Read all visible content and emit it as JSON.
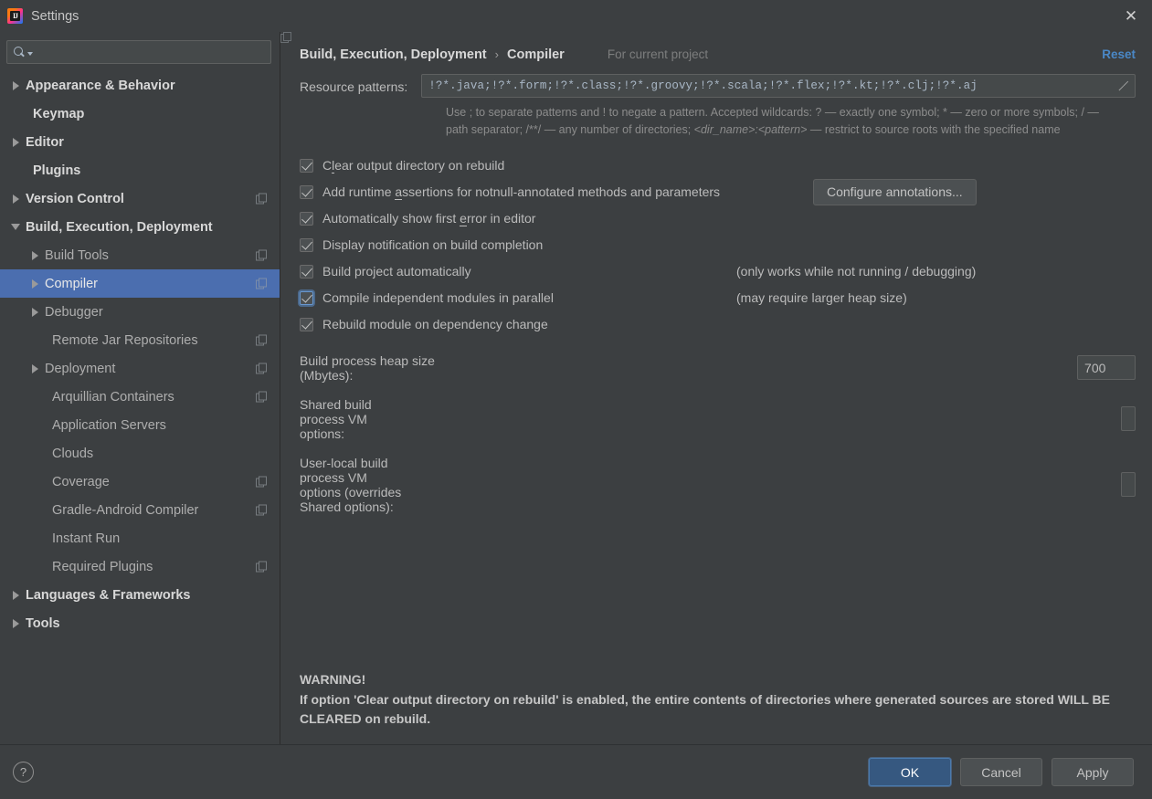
{
  "window": {
    "title": "Settings",
    "app_icon": "intellij-idea-icon",
    "close_icon": "close-icon"
  },
  "sidebar": {
    "search": {
      "placeholder": "",
      "value": "",
      "icon": "search-icon",
      "caret_icon": "chevron-down-icon"
    },
    "items": [
      {
        "label": "Appearance & Behavior",
        "level": 0,
        "arrow": "collapsed",
        "scope_icon": false,
        "selected": false
      },
      {
        "label": "Keymap",
        "level": 0,
        "arrow": "none",
        "scope_icon": false,
        "selected": false
      },
      {
        "label": "Editor",
        "level": 0,
        "arrow": "collapsed",
        "scope_icon": false,
        "selected": false
      },
      {
        "label": "Plugins",
        "level": 0,
        "arrow": "none",
        "scope_icon": false,
        "selected": false
      },
      {
        "label": "Version Control",
        "level": 0,
        "arrow": "collapsed",
        "scope_icon": true,
        "selected": false
      },
      {
        "label": "Build, Execution, Deployment",
        "level": 0,
        "arrow": "expanded",
        "scope_icon": false,
        "selected": false
      },
      {
        "label": "Build Tools",
        "level": 1,
        "arrow": "collapsed",
        "scope_icon": true,
        "selected": false
      },
      {
        "label": "Compiler",
        "level": 1,
        "arrow": "collapsed",
        "scope_icon": true,
        "selected": true
      },
      {
        "label": "Debugger",
        "level": 1,
        "arrow": "collapsed",
        "scope_icon": false,
        "selected": false
      },
      {
        "label": "Remote Jar Repositories",
        "level": 1,
        "arrow": "none",
        "scope_icon": true,
        "selected": false
      },
      {
        "label": "Deployment",
        "level": 1,
        "arrow": "collapsed",
        "scope_icon": true,
        "selected": false
      },
      {
        "label": "Arquillian Containers",
        "level": 1,
        "arrow": "none",
        "scope_icon": true,
        "selected": false
      },
      {
        "label": "Application Servers",
        "level": 1,
        "arrow": "none",
        "scope_icon": false,
        "selected": false
      },
      {
        "label": "Clouds",
        "level": 1,
        "arrow": "none",
        "scope_icon": false,
        "selected": false
      },
      {
        "label": "Coverage",
        "level": 1,
        "arrow": "none",
        "scope_icon": true,
        "selected": false
      },
      {
        "label": "Gradle-Android Compiler",
        "level": 1,
        "arrow": "none",
        "scope_icon": true,
        "selected": false
      },
      {
        "label": "Instant Run",
        "level": 1,
        "arrow": "none",
        "scope_icon": false,
        "selected": false
      },
      {
        "label": "Required Plugins",
        "level": 1,
        "arrow": "none",
        "scope_icon": true,
        "selected": false
      },
      {
        "label": "Languages & Frameworks",
        "level": 0,
        "arrow": "collapsed",
        "scope_icon": false,
        "selected": false
      },
      {
        "label": "Tools",
        "level": 0,
        "arrow": "collapsed",
        "scope_icon": false,
        "selected": false
      }
    ]
  },
  "header": {
    "breadcrumb_root": "Build, Execution, Deployment",
    "breadcrumb_sep": "›",
    "breadcrumb_current": "Compiler",
    "scope_note": "For current project",
    "scope_icon": "project-scope-icon",
    "reset_label": "Reset"
  },
  "main": {
    "resource_patterns": {
      "label": "Resource patterns:",
      "value": "!?*.java;!?*.form;!?*.class;!?*.groovy;!?*.scala;!?*.flex;!?*.kt;!?*.clj;!?*.aj",
      "expand_icon": "expand-icon"
    },
    "hint_parts": {
      "p1": "Use ; to separate patterns and ! to negate a pattern. Accepted wildcards: ? — exactly one symbol; * — zero or more symbols; / — path separator; /**/ — any number of directories; ",
      "p2": "<dir_name>:<pattern>",
      "p3": " — restrict to source roots with the specified name"
    },
    "checkboxes": [
      {
        "label": "Clear output directory on rebuild",
        "mnemonic": "l",
        "checked": true,
        "focused": false,
        "note": "",
        "button": ""
      },
      {
        "label": "Add runtime assertions for notnull-annotated methods and parameters",
        "mnemonic": "a",
        "checked": true,
        "focused": false,
        "note": "",
        "button": "Configure annotations..."
      },
      {
        "label": "Automatically show first error in editor",
        "mnemonic": "e",
        "checked": true,
        "focused": false,
        "note": "",
        "button": ""
      },
      {
        "label": "Display notification on build completion",
        "mnemonic": "",
        "checked": true,
        "focused": false,
        "note": "",
        "button": ""
      },
      {
        "label": "Build project automatically",
        "mnemonic": "",
        "checked": true,
        "focused": false,
        "note": "(only works while not running / debugging)",
        "button": ""
      },
      {
        "label": "Compile independent modules in parallel",
        "mnemonic": "",
        "checked": true,
        "focused": true,
        "note": "(may require larger heap size)",
        "button": ""
      },
      {
        "label": "Rebuild module on dependency change",
        "mnemonic": "",
        "checked": true,
        "focused": false,
        "note": "",
        "button": ""
      }
    ],
    "fields": [
      {
        "label": "Build process heap size (Mbytes):",
        "value": "700",
        "width": "small"
      },
      {
        "label": "Shared build process VM options:",
        "value": "",
        "width": "wide"
      },
      {
        "label": "User-local build process VM options (overrides Shared options):",
        "value": "",
        "width": "wide"
      }
    ],
    "warning": {
      "title": "WARNING!",
      "body": "If option 'Clear output directory on rebuild' is enabled, the entire contents of directories where generated sources are stored WILL BE CLEARED on rebuild."
    }
  },
  "footer": {
    "help_label": "?",
    "ok_label": "OK",
    "cancel_label": "Cancel",
    "apply_label": "Apply"
  },
  "colors": {
    "background": "#3c3f41",
    "selection": "#4b6eaf",
    "accent_link": "#4a88c7",
    "primary_button": "#365880",
    "field_background": "#45494a",
    "text": "#bbbbbb"
  }
}
